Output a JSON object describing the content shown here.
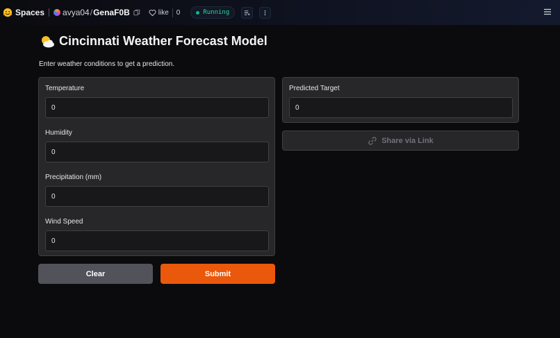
{
  "header": {
    "spaces_label": "Spaces",
    "owner": "avya04",
    "separator": "/",
    "repo": "GenaF0B",
    "like_label": "like",
    "like_count": "0",
    "status": "Running"
  },
  "app": {
    "title": "Cincinnati Weather Forecast Model",
    "description": "Enter weather conditions to get a prediction.",
    "inputs": [
      {
        "label": "Temperature",
        "value": "0"
      },
      {
        "label": "Humidity",
        "value": "0"
      },
      {
        "label": "Precipitation (mm)",
        "value": "0"
      },
      {
        "label": "Wind Speed",
        "value": "0"
      }
    ],
    "output": {
      "label": "Predicted Target",
      "value": "0"
    },
    "share_label": "Share via Link",
    "clear_label": "Clear",
    "submit_label": "Submit"
  },
  "colors": {
    "accent": "#ea580c",
    "status": "#10b981",
    "panel": "#27272a"
  }
}
